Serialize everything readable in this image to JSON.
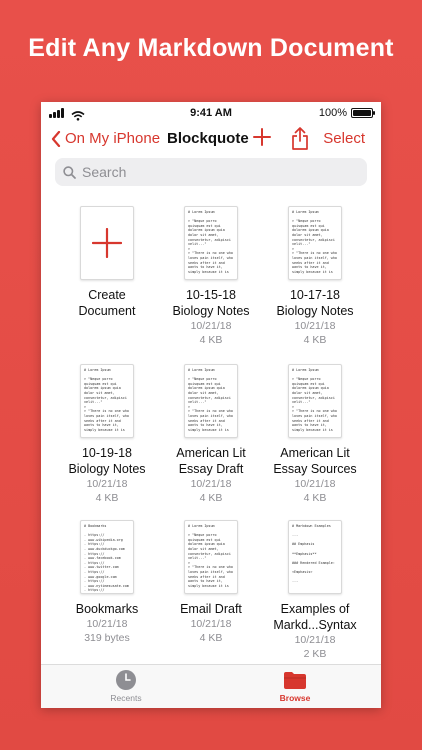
{
  "headline": "Edit Any Markdown Document",
  "status": {
    "time": "9:41 AM",
    "battery": "100%"
  },
  "nav": {
    "back_label": "On My iPhone",
    "title": "Blockquote",
    "select_label": "Select"
  },
  "search": {
    "placeholder": "Search"
  },
  "files": [
    {
      "name_lines": [
        "Create",
        "Document"
      ],
      "date": "",
      "size": "",
      "preview": ""
    },
    {
      "name_lines": [
        "10-15-18",
        "Biology Notes"
      ],
      "date": "10/21/18",
      "size": "4 KB",
      "preview": "# Lorem Ipsum\n\n> \"Neque porro quisquam est qui dolorem ipsum quia dolor sit amet, consectetur, adipisci velit...\"\n>\n> \"There is no one who loves pain itself, who seeks after it and wants to have it, simply because it is"
    },
    {
      "name_lines": [
        "10-17-18",
        "Biology Notes"
      ],
      "date": "10/21/18",
      "size": "4 KB",
      "preview": "# Lorem Ipsum\n\n> \"Neque porro quisquam est qui dolorem ipsum quia dolor sit amet, consectetur, adipisci velit...\"\n>\n> \"There is no one who loves pain itself, who seeks after it and wants to have it, simply because it is"
    },
    {
      "name_lines": [
        "10-19-18",
        "Biology Notes"
      ],
      "date": "10/21/18",
      "size": "4 KB",
      "preview": "# Lorem Ipsum\n\n> \"Neque porro quisquam est qui dolorem ipsum quia dolor sit amet, consectetur, adipisci velit...\"\n>\n> \"There is no one who loves pain itself, who seeks after it and wants to have it, simply because it is"
    },
    {
      "name_lines": [
        "American Lit",
        "Essay Draft"
      ],
      "date": "10/21/18",
      "size": "4 KB",
      "preview": "# Lorem Ipsum\n\n> \"Neque porro quisquam est qui dolorem ipsum quia dolor sit amet, consectetur, adipisci velit...\"\n>\n> \"There is no one who loves pain itself, who seeks after it and wants to have it, simply because it is"
    },
    {
      "name_lines": [
        "American Lit",
        "Essay Sources"
      ],
      "date": "10/21/18",
      "size": "4 KB",
      "preview": "# Lorem Ipsum\n\n> \"Neque porro quisquam est qui dolorem ipsum quia dolor sit amet, consectetur, adipisci velit...\"\n>\n> \"There is no one who loves pain itself, who seeks after it and wants to have it, simply because it is"
    },
    {
      "name_lines": [
        "Bookmarks"
      ],
      "date": "10/21/18",
      "size": "319 bytes",
      "preview": "# Bookmarks\n\n- https://\n- www.wikipedia.org\n- https://\n- www.duckduckgo.com\n- https://\n- www.facebook.com\n- https://\n- www.twitter.com\n- https://\n- www.google.com\n- https://\n- www.nytimesusate.com\n- https://"
    },
    {
      "name_lines": [
        "Email Draft"
      ],
      "date": "10/21/18",
      "size": "4 KB",
      "preview": "# Lorem Ipsum\n\n> \"Neque porro quisquam est qui dolorem ipsum quia dolor sit amet, consectetur, adipisci velit...\"\n>\n> \"There is no one who loves pain itself, who seeks after it and wants to have it, simply because it is"
    },
    {
      "name_lines": [
        "Examples of",
        "Markd...Syntax"
      ],
      "date": "10/21/18",
      "size": "2 KB",
      "preview": "# Markdown Examples\n\n---\n\n## Emphasis\n\n**Emphasis**\n\n### Rendered Example:\n\n<Emphasis>\n\n---"
    }
  ],
  "tabs": {
    "recents": "Recents",
    "browse": "Browse"
  },
  "colors": {
    "accent": "#d7372e",
    "background": "#e14a43"
  }
}
